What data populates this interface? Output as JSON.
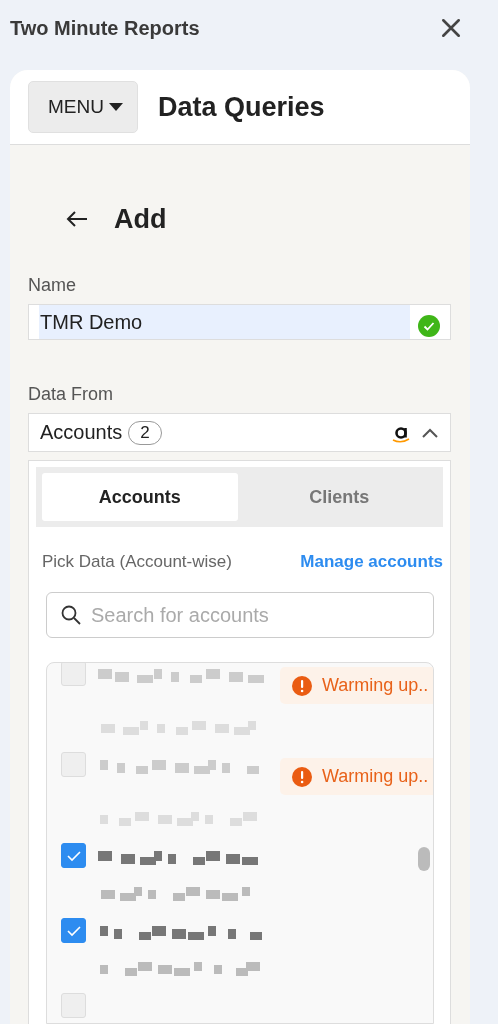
{
  "window": {
    "title": "Two Minute Reports"
  },
  "header": {
    "menu_label": "MENU",
    "title": "Data Queries"
  },
  "page": {
    "title": "Add"
  },
  "name_field": {
    "label": "Name",
    "value": "TMR Demo",
    "valid": true
  },
  "data_from": {
    "label": "Data From",
    "value": "Accounts",
    "count": "2",
    "expanded": true
  },
  "tabs": [
    {
      "label": "Accounts",
      "selected": true
    },
    {
      "label": "Clients",
      "selected": false
    }
  ],
  "pick": {
    "label": "Pick Data (Account-wise)",
    "link": "Manage accounts"
  },
  "search": {
    "placeholder": "Search for accounts"
  },
  "accounts": [
    {
      "checked": false,
      "status": "Warming up.."
    },
    {
      "checked": false,
      "status": "Warming up.."
    },
    {
      "checked": true
    },
    {
      "checked": true
    },
    {
      "checked": false
    }
  ]
}
